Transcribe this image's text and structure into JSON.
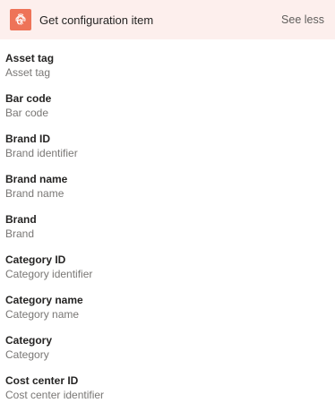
{
  "header": {
    "title": "Get configuration item",
    "toggle_label": "See less",
    "icon": "fingerprint-icon",
    "icon_bg": "#ee7358",
    "bg": "#fdefed"
  },
  "fields": [
    {
      "name": "Asset tag",
      "description": "Asset tag"
    },
    {
      "name": "Bar code",
      "description": "Bar code"
    },
    {
      "name": "Brand ID",
      "description": "Brand identifier"
    },
    {
      "name": "Brand name",
      "description": "Brand name"
    },
    {
      "name": "Brand",
      "description": "Brand"
    },
    {
      "name": "Category ID",
      "description": "Category identifier"
    },
    {
      "name": "Category name",
      "description": "Category name"
    },
    {
      "name": "Category",
      "description": "Category"
    },
    {
      "name": "Cost center ID",
      "description": "Cost center identifier"
    }
  ]
}
